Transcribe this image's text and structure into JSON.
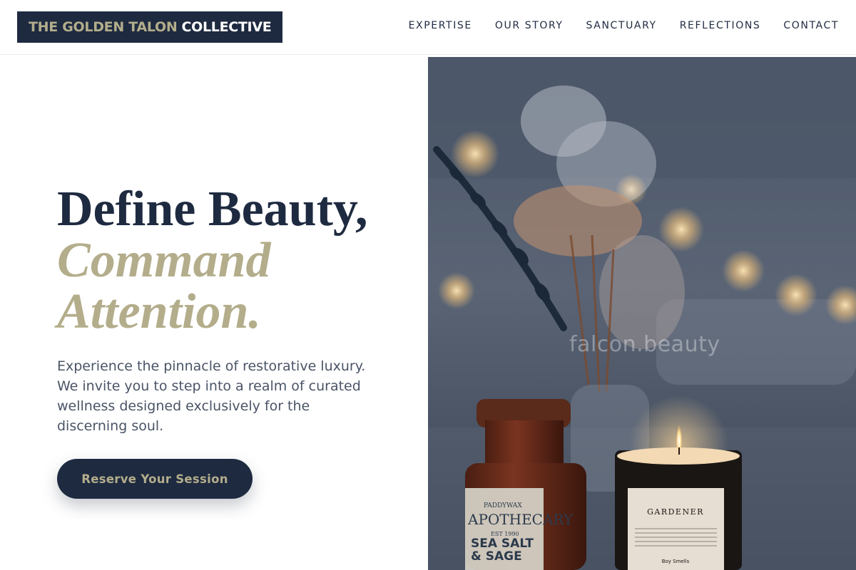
{
  "brand": {
    "name_part1": "THE GOLDEN TALON",
    "name_part2": "COLLECTIVE"
  },
  "nav": {
    "items": [
      {
        "label": "EXPERTISE"
      },
      {
        "label": "OUR STORY"
      },
      {
        "label": "SANCTUARY"
      },
      {
        "label": "REFLECTIONS"
      },
      {
        "label": "CONTACT"
      }
    ]
  },
  "hero": {
    "title_line1": "Define Beauty,",
    "title_line2": "Command",
    "title_line3": "Attention.",
    "description": "Experience the pinnacle of restorative luxury. We invite you to step into a realm of curated wellness designed exclusively for the discerning soul.",
    "cta_label": "Reserve Your Session"
  },
  "image": {
    "watermark": "falcon.beauty",
    "jar_label_brand": "PADDYWAX",
    "jar_label_title": "APOTHECARY",
    "jar_label_est": "EST 1990",
    "jar_label_scent_line1": "SEA SALT",
    "jar_label_scent_line2": "& SAGE",
    "candle_label_title": "GARDENER",
    "candle_label_footer": "Boy Smells"
  },
  "colors": {
    "navy": "#1e2a40",
    "gold": "#b3ad8b",
    "body_text": "#4a5466"
  }
}
